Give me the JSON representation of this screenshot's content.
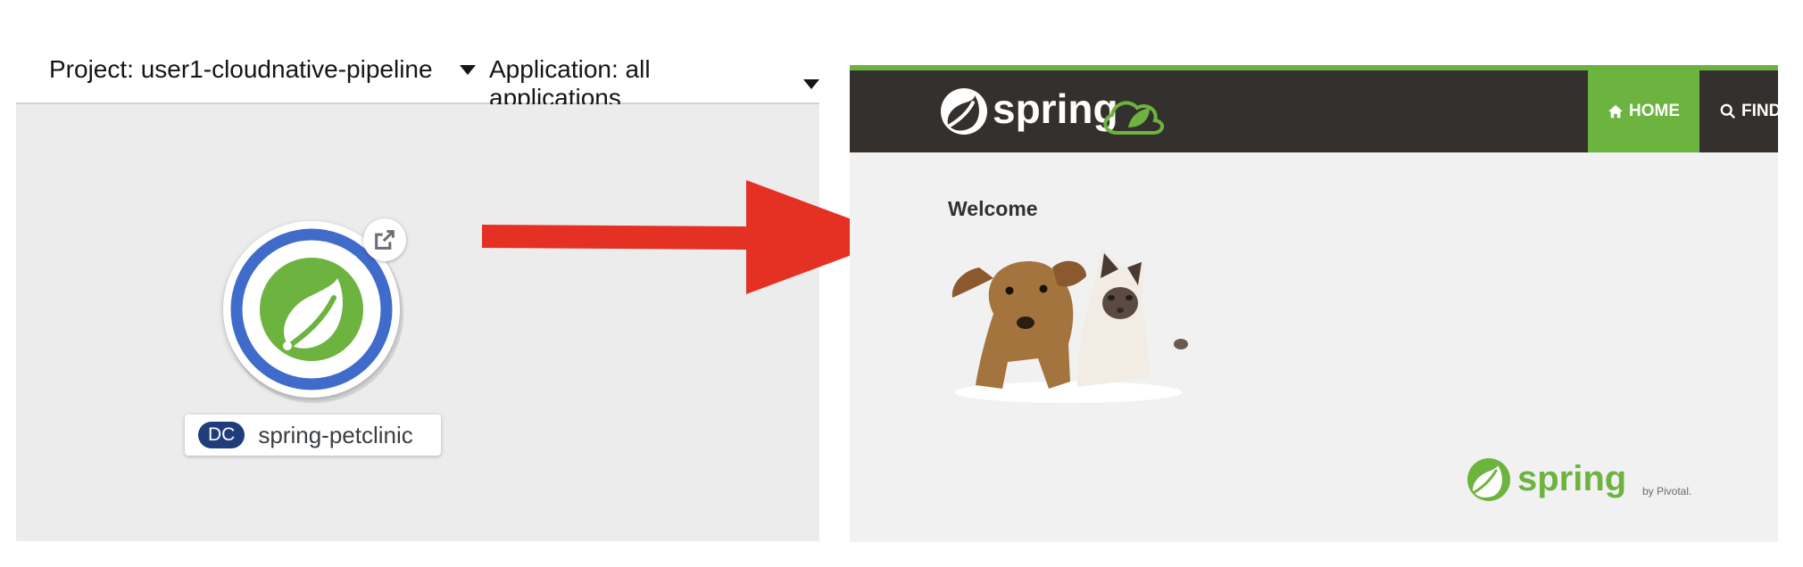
{
  "topology": {
    "project_selector": "Project: user1-cloudnative-pipeline",
    "application_selector": "Application: all applications",
    "node": {
      "kind_badge": "DC",
      "name": "spring-petclinic",
      "ring_color": "#3f6ccb",
      "icon": "spring-leaf-icon",
      "decorator": "external-link-icon"
    }
  },
  "arrow": {
    "color": "#e53124"
  },
  "petclinic": {
    "brand": "spring",
    "nav": {
      "home": "HOME",
      "find": "FIND"
    },
    "welcome": "Welcome",
    "image": "pets-image",
    "footer_brand": "spring",
    "footer_by": "by Pivotal.",
    "accent_color": "#6db33f",
    "nav_bg": "#34302d"
  }
}
